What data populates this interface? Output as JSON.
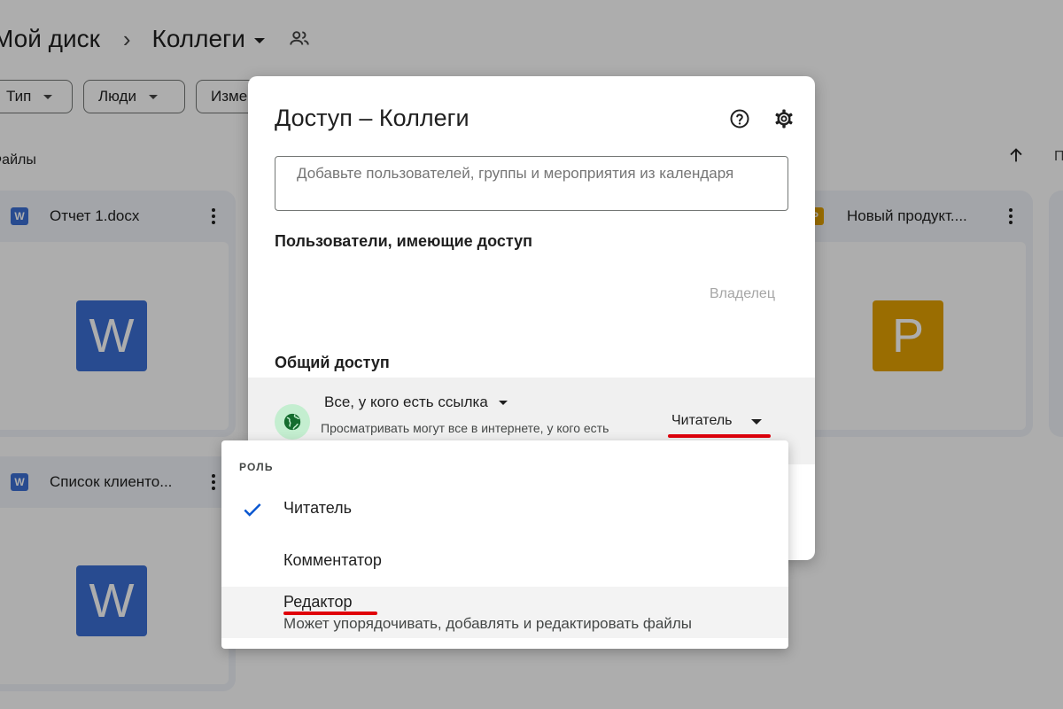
{
  "breadcrumb": {
    "root": "Мой диск",
    "separator": "›",
    "current": "Коллеги"
  },
  "filters": [
    "Тип",
    "Люди",
    "Изме"
  ],
  "files_label": "Файлы",
  "column_label": "П",
  "files": [
    {
      "name": "Отчет 1.docx",
      "type_letter": "W",
      "color": "#3b6fd4"
    },
    {
      "name": "Новый продукт....",
      "type_letter": "P",
      "color": "#e3a102"
    },
    {
      "name": "Список клиенто...",
      "type_letter": "W",
      "color": "#3b6fd4"
    }
  ],
  "dialog": {
    "title": "Доступ – Коллеги",
    "add_placeholder": "Добавьте пользователей, группы и мероприятия из календаря",
    "users_heading": "Пользователи, имеющие доступ",
    "owner_label": "Владелец",
    "general_heading": "Общий доступ",
    "link_scope": "Все, у кого есть ссылка",
    "link_description": "Просматривать могут все в интернете, у кого есть",
    "current_role": "Читатель"
  },
  "role_menu": {
    "heading": "РОЛЬ",
    "items": [
      {
        "label": "Читатель",
        "selected": true
      },
      {
        "label": "Комментатор",
        "selected": false
      },
      {
        "label": "Редактор",
        "selected": false,
        "description": "Может упорядочивать, добавлять и редактировать файлы"
      }
    ]
  },
  "colors": {
    "annotation_underline": "#e0000b",
    "globe_background": "#c4eed0",
    "check_blue": "#0b57d0"
  }
}
